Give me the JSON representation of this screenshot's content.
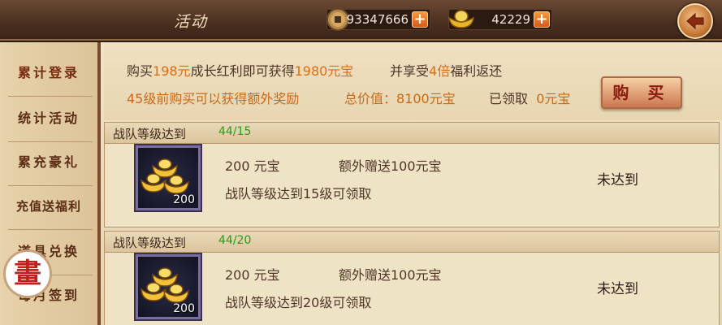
{
  "header": {
    "title": "活动",
    "copper": "93347666",
    "ingots": "42229",
    "plus_label": "+"
  },
  "sidebar": {
    "items": [
      {
        "label": "累计登录"
      },
      {
        "label": "统计活动"
      },
      {
        "label": "累充豪礼"
      },
      {
        "label": "充值送福利"
      },
      {
        "label": "道具兑换"
      },
      {
        "label": "每月签到"
      }
    ],
    "seal_char": "畫"
  },
  "banner": {
    "l1_a": "购买",
    "l1_price": "198元",
    "l1_b": "成长红利即可获得",
    "l1_amount": "1980元宝",
    "l1_c": "并享受",
    "l1_mult": "4倍",
    "l1_d": "福利返还",
    "l2_a": "45级前购买可以获得额外奖励",
    "l2_total_label": "总价值：",
    "l2_total": "8100元宝",
    "l2_claimed_label": "已领取",
    "l2_claimed": "0元宝",
    "buy_label": "购 买"
  },
  "cards": [
    {
      "head_label": "战队等级达到",
      "progress": "44/15",
      "reward_count": "200",
      "amount": "200 元宝",
      "bonus": "额外赠送100元宝",
      "condition": "战队等级达到15级可领取",
      "status": "未达到"
    },
    {
      "head_label": "战队等级达到",
      "progress": "44/20",
      "reward_count": "200",
      "amount": "200 元宝",
      "bonus": "额外赠送100元宝",
      "condition": "战队等级达到20级可领取",
      "status": "未达到"
    }
  ],
  "icons": [
    "copper-coin-icon",
    "gold-ingot-icon",
    "plus-icon",
    "back-arrow-icon",
    "gold-ingots-icon"
  ],
  "colors": {
    "accent": "#e06d10",
    "progress": "#2d9a1e",
    "buy_text": "#8a1a0c"
  }
}
